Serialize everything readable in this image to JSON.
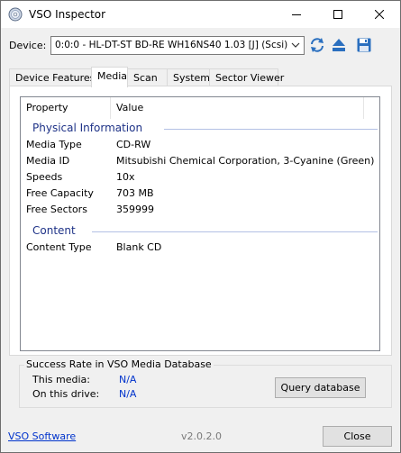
{
  "window": {
    "title": "VSO Inspector",
    "app_icon": "disc-icon",
    "controls": [
      "minimize-icon",
      "maximize-icon",
      "close-icon"
    ]
  },
  "device": {
    "label": "Device:",
    "selected": "0:0:0 - HL-DT-ST BD-RE  WH16NS40 1.03 [J] (Scsi)",
    "buttons": [
      "refresh-icon",
      "eject-icon",
      "save-icon"
    ]
  },
  "tabs": [
    "Device Features",
    "Media",
    "Scan",
    "System",
    "Sector Viewer"
  ],
  "active_tab": "Media",
  "list": {
    "columns": [
      "Property",
      "Value"
    ],
    "groups": [
      {
        "title": "Physical Information",
        "rows": [
          {
            "property": "Media Type",
            "value": "CD-RW"
          },
          {
            "property": "Media ID",
            "value": "Mitsubishi Chemical Corporation, 3-Cyanine (Green)"
          },
          {
            "property": "Speeds",
            "value": "10x"
          },
          {
            "property": "Free Capacity",
            "value": "703 MB"
          },
          {
            "property": "Free Sectors",
            "value": "359999"
          }
        ]
      },
      {
        "title": "Content",
        "rows": [
          {
            "property": "Content Type",
            "value": "Blank CD"
          }
        ]
      }
    ]
  },
  "database": {
    "title": "Success Rate in VSO Media Database",
    "this_media_label": "This media:",
    "this_media_value": "N/A",
    "this_drive_label": "On this drive:",
    "this_drive_value": "N/A",
    "query_button": "Query database"
  },
  "footer": {
    "link": "VSO Software",
    "version": "v2.0.2.0",
    "close_button": "Close"
  },
  "colors": {
    "link": "#0033cc",
    "group_header": "#1e3287",
    "window_bg": "#f0f0f0"
  }
}
